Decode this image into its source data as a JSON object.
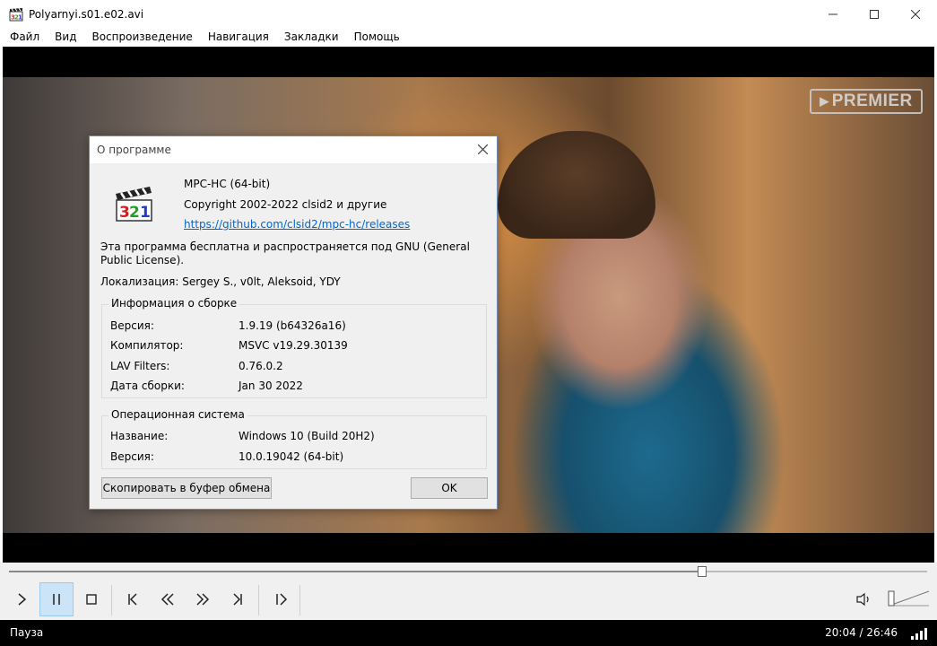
{
  "window": {
    "title": "Polyarnyi.s01.e02.avi",
    "minimize_icon": "minimize-icon",
    "maximize_icon": "maximize-icon",
    "close_icon": "close-icon"
  },
  "menu": [
    "Файл",
    "Вид",
    "Воспроизведение",
    "Навигация",
    "Закладки",
    "Помощь"
  ],
  "video": {
    "watermark": "PREMIER"
  },
  "about_dialog": {
    "title": "О программе",
    "app_name": "MPC-HC (64-bit)",
    "copyright": "Copyright 2002-2022 clsid2 и другие",
    "link": "https://github.com/clsid2/mpc-hc/releases",
    "license": "Эта программа бесплатна и распространяется под GNU (General Public License).",
    "localization": "Локализация: Sergey S., v0lt, Aleksoid, YDY",
    "build_group": {
      "label": "Информация о сборке",
      "rows": [
        {
          "key": "Версия:",
          "value": "1.9.19 (b64326a16)"
        },
        {
          "key": "Компилятор:",
          "value": "MSVC v19.29.30139"
        },
        {
          "key": "LAV Filters:",
          "value": "0.76.0.2"
        },
        {
          "key": "Дата сборки:",
          "value": "Jan 30 2022"
        }
      ]
    },
    "os_group": {
      "label": "Операционная система",
      "rows": [
        {
          "key": "Название:",
          "value": "Windows 10 (Build 20H2)"
        },
        {
          "key": "Версия:",
          "value": "10.0.19042 (64-bit)"
        }
      ]
    },
    "copy_button": "Скопировать в буфер обмена",
    "ok_button": "OK"
  },
  "playback": {
    "progress": 0.755,
    "volume": 0.0,
    "status": "Пауза",
    "time": "20:04 / 26:46"
  },
  "colors": {
    "accent_active": "#cce4f7",
    "link": "#0066cc"
  }
}
